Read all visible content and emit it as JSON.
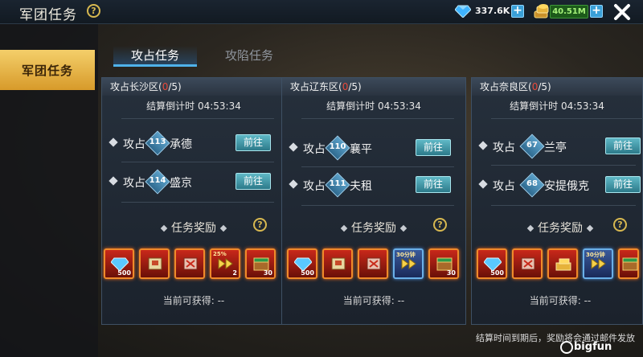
{
  "header": {
    "title": "军团任务",
    "help": "?",
    "gems": "337.6K",
    "gold": "40.51M",
    "plus": "+"
  },
  "nav": {
    "active": "军团任务"
  },
  "tabs": {
    "active": "攻占任务",
    "other": "攻陷任务"
  },
  "panels": [
    {
      "region": "攻占长沙区",
      "progress_open": "(",
      "progress_done": "0",
      "progress_rest": "/5)",
      "countdown": "结算倒计时 04:53:34",
      "tasks": [
        {
          "action": "攻占",
          "level": "113",
          "city": "承德",
          "button": "前往"
        },
        {
          "action": "攻占",
          "level": "114",
          "city": "盛京",
          "button": "前往"
        }
      ],
      "reward_title": "任务奖励",
      "reward_items": [
        {
          "tag": "",
          "qty": "500"
        },
        {
          "tag": "",
          "qty": ""
        },
        {
          "tag": "",
          "qty": ""
        },
        {
          "tag": "25%",
          "qty": "2"
        },
        {
          "tag": "",
          "qty": "30"
        }
      ],
      "current": "当前可获得: --"
    },
    {
      "region": "攻占辽东区",
      "progress_open": "(",
      "progress_done": "0",
      "progress_rest": "/5)",
      "countdown": "结算倒计时 04:53:34",
      "tasks": [
        {
          "action": "攻占",
          "level": "110",
          "city": "襄平",
          "button": "前往"
        },
        {
          "action": "攻占",
          "level": "111",
          "city": "夫租",
          "button": "前往"
        }
      ],
      "reward_title": "任务奖励",
      "reward_items": [
        {
          "tag": "",
          "qty": "500"
        },
        {
          "tag": "",
          "qty": ""
        },
        {
          "tag": "",
          "qty": ""
        },
        {
          "tag": "30分钟",
          "qty": ""
        },
        {
          "tag": "",
          "qty": "30"
        }
      ],
      "current": "当前可获得: --"
    },
    {
      "region": "攻占奈良区",
      "progress_open": "(",
      "progress_done": "0",
      "progress_rest": "/5)",
      "countdown": "结算倒计时 04:53:34",
      "tasks": [
        {
          "action": "攻占",
          "level": "67",
          "city": "兰亭",
          "button": "前往"
        },
        {
          "action": "攻占",
          "level": "68",
          "city": "安提俄克",
          "button": "前往"
        }
      ],
      "reward_title": "任务奖励",
      "reward_items": [
        {
          "tag": "",
          "qty": "500"
        },
        {
          "tag": "",
          "qty": ""
        },
        {
          "tag": "",
          "qty": ""
        },
        {
          "tag": "30分钟",
          "qty": ""
        },
        {
          "tag": "",
          "qty": ""
        }
      ],
      "current": "当前可获得: --"
    }
  ],
  "footnote": "结算时间到期后，奖励将会通过邮件发放",
  "watermark": "bigfun",
  "colors": {
    "accent_gold": "#d79a2a",
    "tab_blue": "#4fb2ea",
    "progress_red": "#e94a3a"
  },
  "icons": [
    "help-icon",
    "gem-icon",
    "gold-coins-icon",
    "plus-icon",
    "close-icon",
    "diamond-bullet-icon",
    "level-badge-icon"
  ]
}
